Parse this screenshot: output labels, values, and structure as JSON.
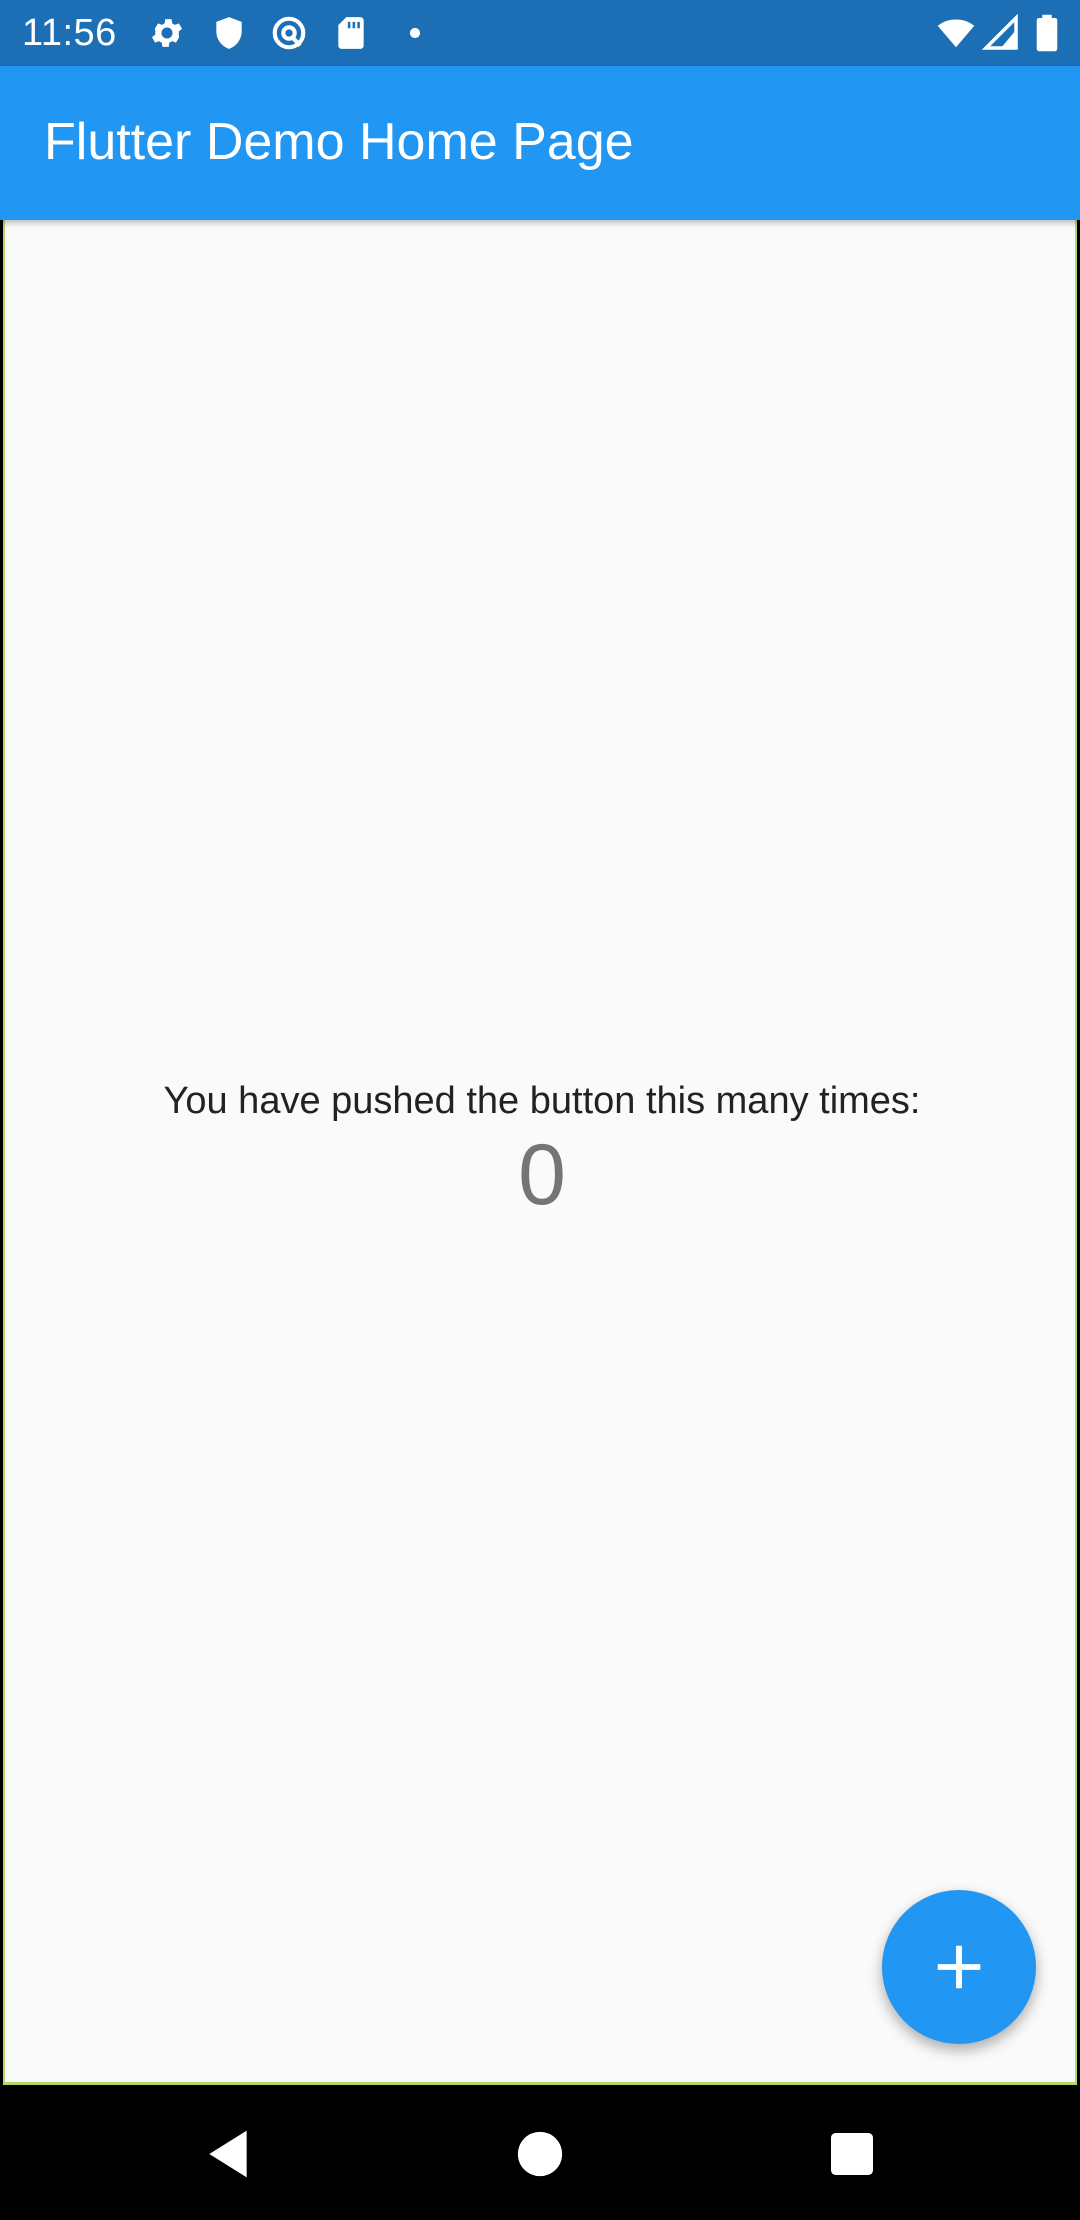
{
  "status_bar": {
    "time": "11:56",
    "left_icons": [
      "gear-icon",
      "shield-icon",
      "at-sign-icon",
      "sd-card-icon",
      "dot-icon"
    ],
    "right_icons": [
      "wifi-icon",
      "cellular-signal-icon",
      "battery-icon"
    ],
    "color": "#1c6fb5"
  },
  "app_bar": {
    "title": "Flutter Demo Home Page",
    "color": "#2196f3"
  },
  "body": {
    "counter_label": "You have pushed the button this many times:",
    "counter_value": "0"
  },
  "fab": {
    "icon": "plus-icon",
    "color": "#2196f3"
  },
  "nav_bar": {
    "buttons": [
      "back-triangle-icon",
      "home-circle-icon",
      "recents-square-icon"
    ]
  }
}
